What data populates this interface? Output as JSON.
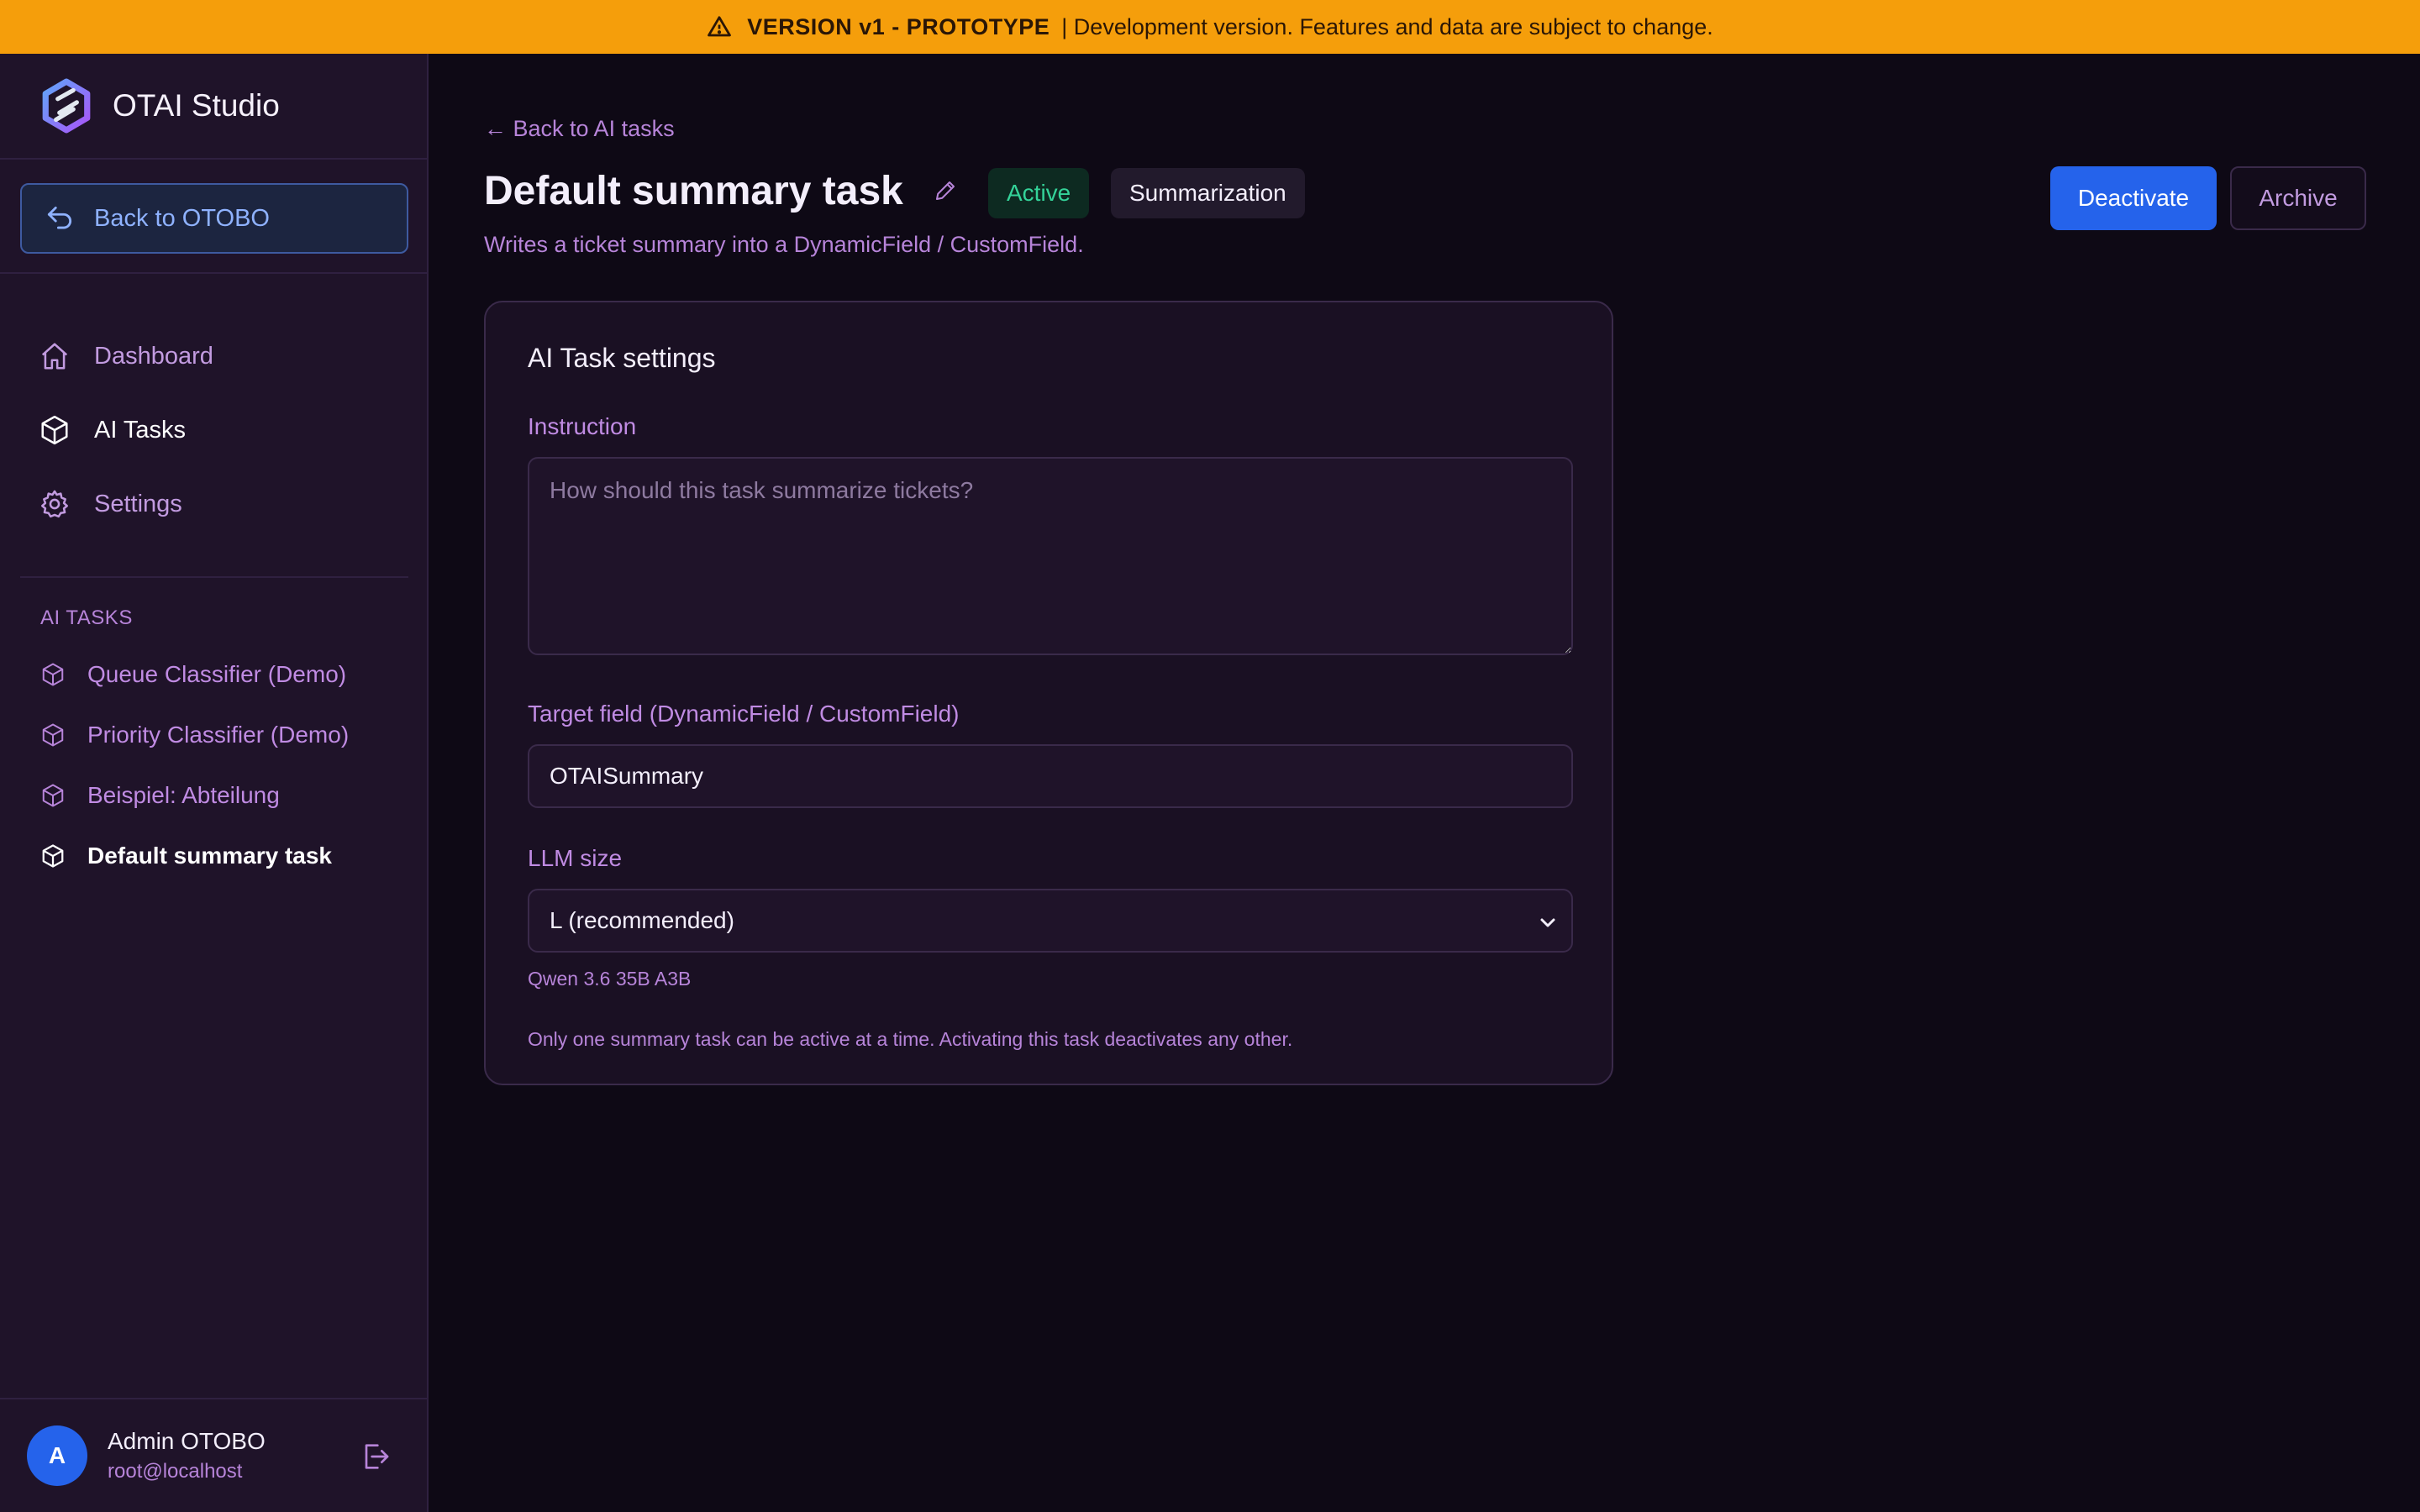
{
  "banner": {
    "icon": "warning-triangle-icon",
    "version": "VERSION v1 - PROTOTYPE",
    "message": "| Development version. Features and data are subject to change."
  },
  "sidebar": {
    "brand": "OTAI Studio",
    "back_button": "Back to OTOBO",
    "nav": [
      {
        "label": "Dashboard",
        "icon": "home-icon"
      },
      {
        "label": "AI Tasks",
        "icon": "cube-icon"
      },
      {
        "label": "Settings",
        "icon": "gear-icon"
      }
    ],
    "section_label": "AI TASKS",
    "tasks": [
      {
        "label": "Queue Classifier (Demo)"
      },
      {
        "label": "Priority Classifier (Demo)"
      },
      {
        "label": "Beispiel: Abteilung"
      },
      {
        "label": "Default summary task"
      }
    ],
    "user": {
      "initial": "A",
      "name": "Admin OTOBO",
      "email": "root@localhost"
    }
  },
  "main": {
    "back_link": "← Back to AI tasks",
    "title": "Default summary task",
    "status_badge": "Active",
    "type_badge": "Summarization",
    "subtitle": "Writes a ticket summary into a DynamicField / CustomField.",
    "deactivate_label": "Deactivate",
    "archive_label": "Archive"
  },
  "card": {
    "title": "AI Task settings",
    "instruction_label": "Instruction",
    "instruction_placeholder": "How should this task summarize tickets?",
    "target_label": "Target field (DynamicField / CustomField)",
    "target_value": "OTAISummary",
    "llm_label": "LLM size",
    "llm_value": "L (recommended)",
    "llm_model": "Qwen 3.6 35B A3B",
    "note": "Only one summary task can be active at a time. Activating this task deactivates any other."
  },
  "colors": {
    "banner": "#f59e0b",
    "primary": "#2563eb",
    "active_badge": "#34d399",
    "accent_text": "#c08be3"
  }
}
